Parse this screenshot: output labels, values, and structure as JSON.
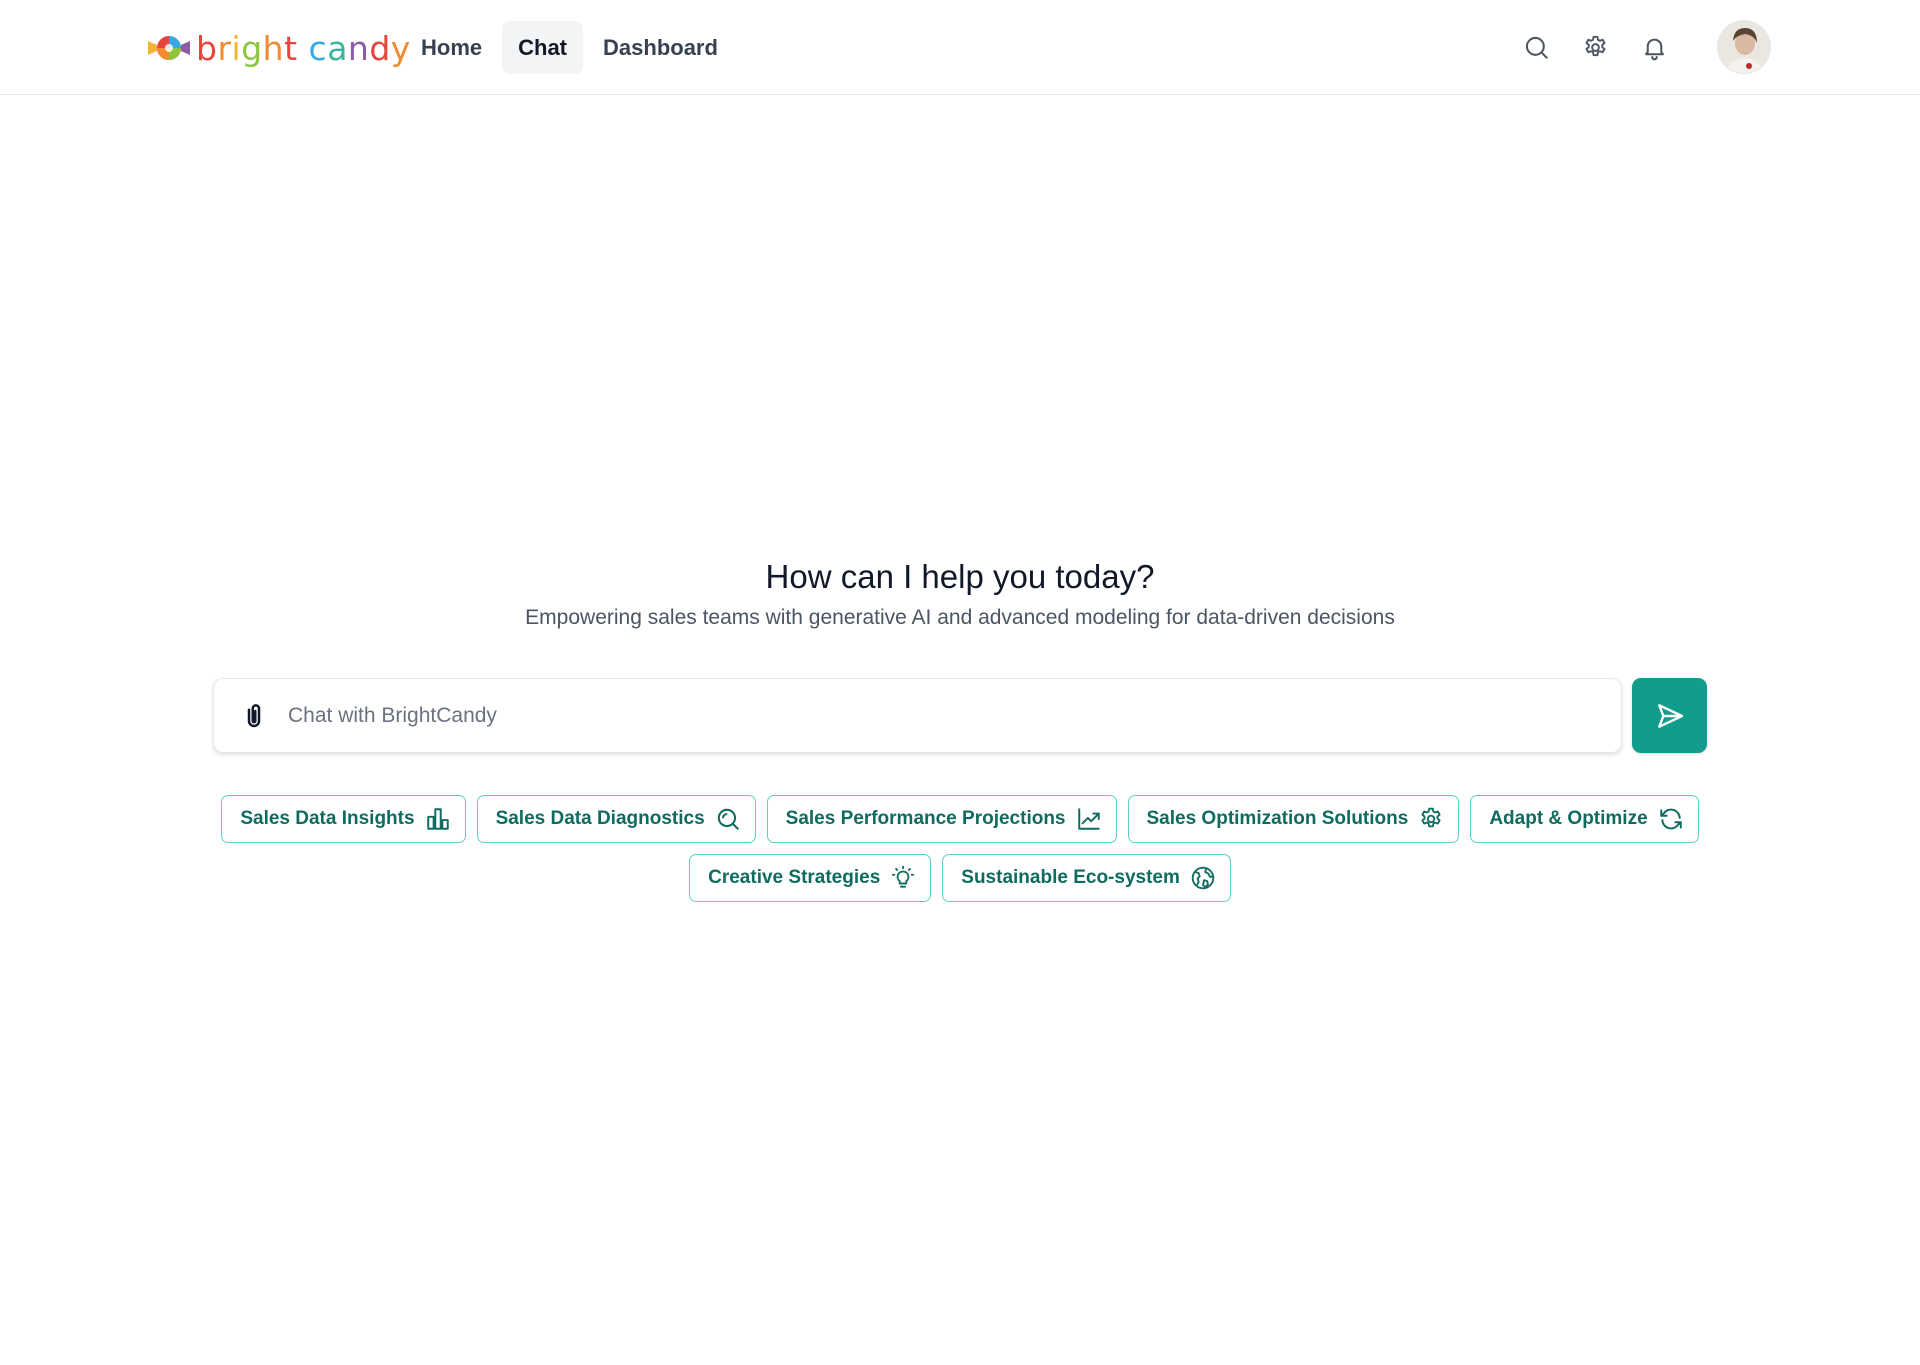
{
  "brand": {
    "name_parts": [
      {
        "text": "b",
        "color": "#e8453c"
      },
      {
        "text": "r",
        "color": "#f28b30"
      },
      {
        "text": "i",
        "color": "#f2b632"
      },
      {
        "text": "g",
        "color": "#8cc63f"
      },
      {
        "text": "h",
        "color": "#f28b30"
      },
      {
        "text": "t",
        "color": "#e8453c"
      },
      {
        "text": " ",
        "color": "#ffffff"
      },
      {
        "text": "c",
        "color": "#36a9e1"
      },
      {
        "text": "a",
        "color": "#3ab5a0"
      },
      {
        "text": "n",
        "color": "#8e5ba8"
      },
      {
        "text": "d",
        "color": "#e8453c"
      },
      {
        "text": "y",
        "color": "#f28b30"
      }
    ],
    "logo_icon": "candy-icon"
  },
  "nav": {
    "items": [
      {
        "label": "Home",
        "active": false
      },
      {
        "label": "Chat",
        "active": true
      },
      {
        "label": "Dashboard",
        "active": false
      }
    ]
  },
  "header_icons": [
    "search-icon",
    "gear-icon",
    "bell-icon"
  ],
  "hero": {
    "title": "How can I help you today?",
    "subtitle": "Empowering sales teams with generative AI and advanced modeling for data-driven decisions"
  },
  "chat": {
    "placeholder": "Chat with BrightCandy",
    "value": ""
  },
  "suggestions": {
    "row1": [
      {
        "label": "Sales Data Insights",
        "icon": "bar-chart-icon"
      },
      {
        "label": "Sales Data Diagnostics",
        "icon": "magnifier-icon"
      },
      {
        "label": "Sales Performance Projections",
        "icon": "trend-up-icon"
      },
      {
        "label": "Sales Optimization Solutions",
        "icon": "gear-icon"
      },
      {
        "label": "Adapt & Optimize",
        "icon": "refresh-icon"
      }
    ],
    "row2": [
      {
        "label": "Creative Strategies",
        "icon": "lightbulb-icon"
      },
      {
        "label": "Sustainable Eco-system",
        "icon": "globe-icon"
      }
    ]
  },
  "colors": {
    "accent": "#129c8b",
    "chip_border": "#5fd3c2",
    "chip_text": "#0f6b60"
  }
}
